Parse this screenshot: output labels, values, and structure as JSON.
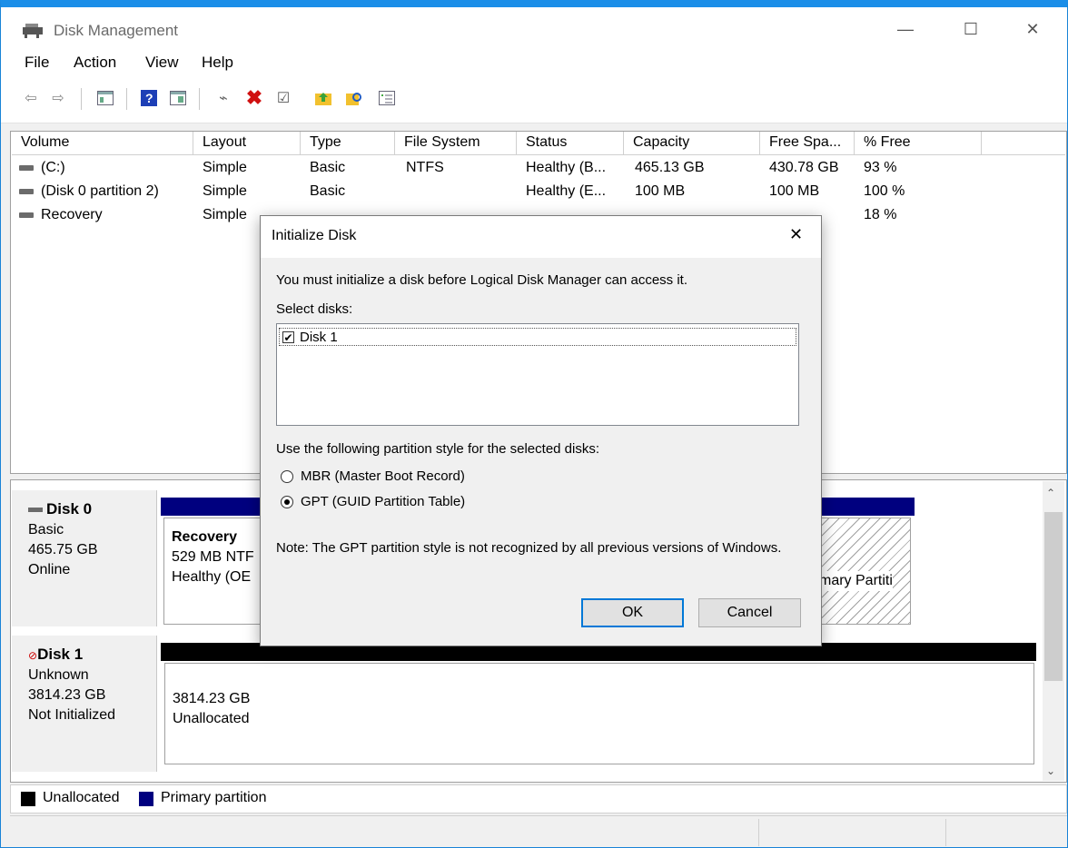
{
  "window": {
    "title": "Disk Management",
    "minimize": "—",
    "maximize": "☐",
    "close": "✕"
  },
  "menu": [
    "File",
    "Action",
    "View",
    "Help"
  ],
  "toolbar_icons": [
    "back-arrow-icon",
    "forward-arrow-icon",
    "console-tree-icon",
    "help-icon",
    "properties-icon",
    "connect-icon",
    "delete-icon",
    "check-icon",
    "folder-up-icon",
    "search-folder-icon",
    "list-icon"
  ],
  "columns": [
    "Volume",
    "Layout",
    "Type",
    "File System",
    "Status",
    "Capacity",
    "Free Spa...",
    "% Free"
  ],
  "volumes": [
    {
      "volume": "(C:)",
      "layout": "Simple",
      "type": "Basic",
      "fs": "NTFS",
      "status": "Healthy (B...",
      "capacity": "465.13 GB",
      "free": "430.78 GB",
      "pct": "93 %"
    },
    {
      "volume": "(Disk 0 partition 2)",
      "layout": "Simple",
      "type": "Basic",
      "fs": "",
      "status": "Healthy (E...",
      "capacity": "100 MB",
      "free": "100 MB",
      "pct": "100 %"
    },
    {
      "volume": "Recovery",
      "layout": "Simple",
      "type": "",
      "fs": "",
      "status": "",
      "capacity": "",
      "free": "",
      "pct": "18 %"
    }
  ],
  "disk0": {
    "name": "Disk 0",
    "type": "Basic",
    "size": "465.75 GB",
    "state": "Online",
    "recovery": {
      "name": "Recovery",
      "size": "529 MB NTF",
      "health": "Healthy (OE"
    },
    "primary_label": "mary Partiti"
  },
  "disk1": {
    "name": "Disk 1",
    "type": "Unknown",
    "size": "3814.23 GB",
    "state": "Not Initialized",
    "unallocated": {
      "size": "3814.23 GB",
      "label": "Unallocated"
    }
  },
  "legend": {
    "unallocated": "Unallocated",
    "primary": "Primary partition"
  },
  "colors": {
    "unallocated": "#000000",
    "primary": "#00007f",
    "accent": "#0078d7"
  },
  "dialog": {
    "title": "Initialize Disk",
    "close": "✕",
    "intro": "You must initialize a disk before Logical Disk Manager can access it.",
    "select_label": "Select disks:",
    "disks": [
      {
        "label": "Disk 1",
        "checked": true
      }
    ],
    "style_label": "Use the following partition style for the selected disks:",
    "options": [
      {
        "label": "MBR (Master Boot Record)",
        "selected": false
      },
      {
        "label": "GPT (GUID Partition Table)",
        "selected": true
      }
    ],
    "note": "Note: The GPT partition style is not recognized by all previous versions of Windows.",
    "ok": "OK",
    "cancel": "Cancel"
  }
}
